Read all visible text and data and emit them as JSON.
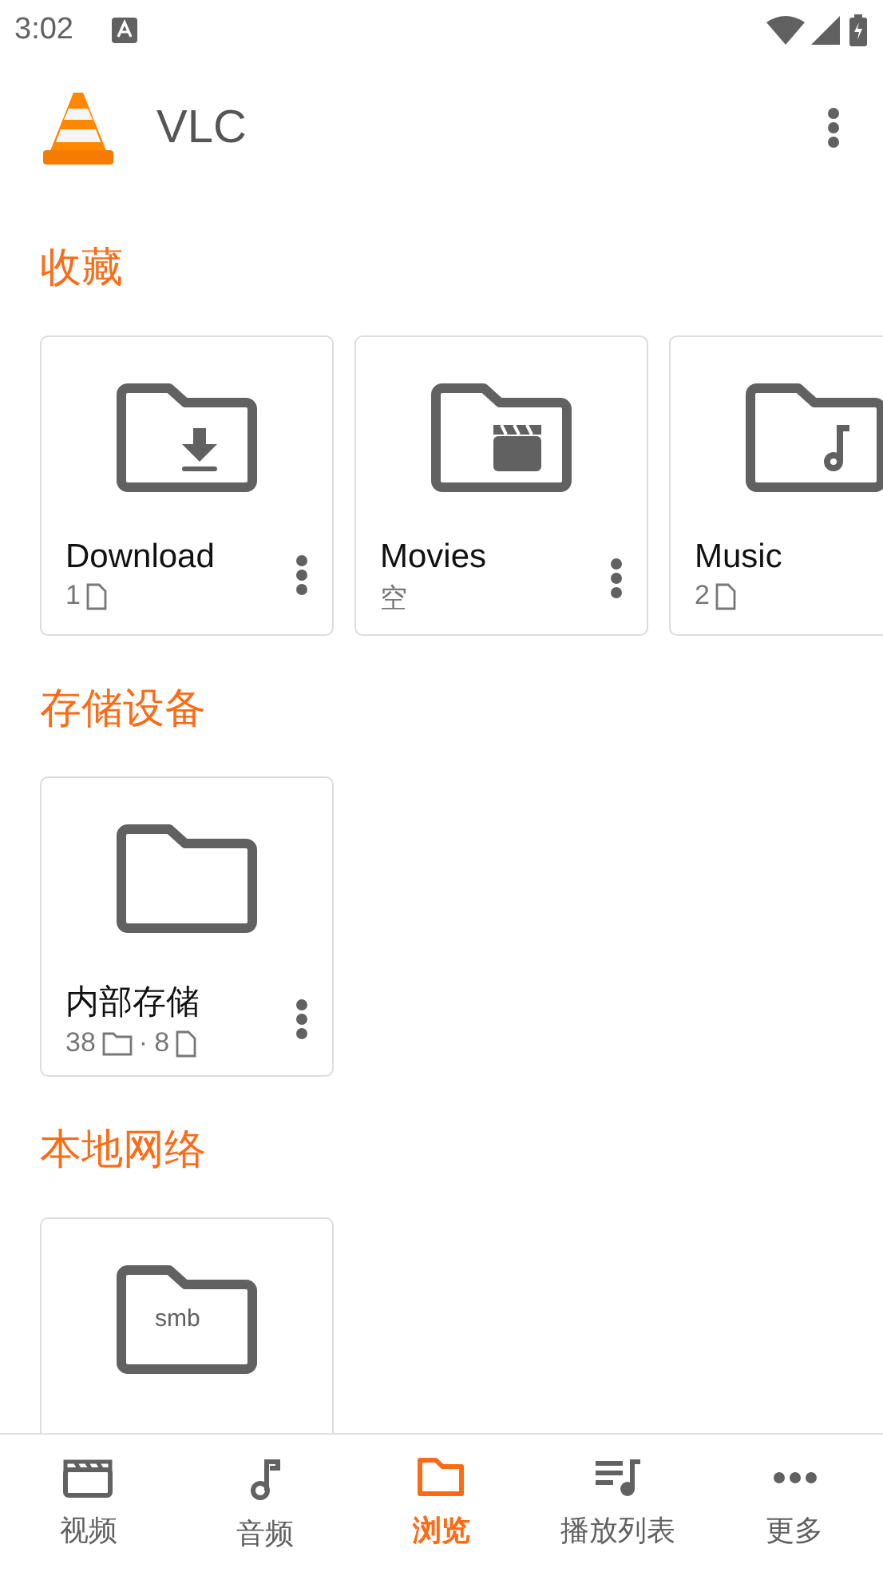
{
  "status_bar": {
    "time": "3:02"
  },
  "app_bar": {
    "title": "VLC"
  },
  "sections": [
    {
      "title": "收藏",
      "cards": [
        {
          "name": "Download",
          "kind": "download",
          "menu": true,
          "meta": [
            {
              "text": "1",
              "kind": "file"
            }
          ]
        },
        {
          "name": "Movies",
          "kind": "movies",
          "menu": true,
          "meta": [
            {
              "text": "空",
              "kind": "text"
            }
          ]
        },
        {
          "name": "Music",
          "kind": "music",
          "meta": [
            {
              "text": "2",
              "kind": "file"
            }
          ]
        }
      ]
    },
    {
      "title": "存储设备",
      "cards": [
        {
          "name": "内部存储",
          "kind": "plain",
          "menu": true,
          "meta": [
            {
              "text": "38",
              "kind": "folder"
            },
            {
              "text": "·",
              "kind": "text"
            },
            {
              "text": "8",
              "kind": "file"
            }
          ]
        }
      ]
    },
    {
      "title": "本地网络",
      "cards": [
        {
          "kind": "network",
          "badge": "smb"
        }
      ]
    }
  ],
  "nav": [
    {
      "label": "视频",
      "kind": "video",
      "selected": false
    },
    {
      "label": "音频",
      "kind": "audio",
      "selected": false
    },
    {
      "label": "浏览",
      "kind": "browse",
      "selected": true
    },
    {
      "label": "播放列表",
      "kind": "playlist",
      "selected": false
    },
    {
      "label": "更多",
      "kind": "more",
      "selected": false
    }
  ]
}
